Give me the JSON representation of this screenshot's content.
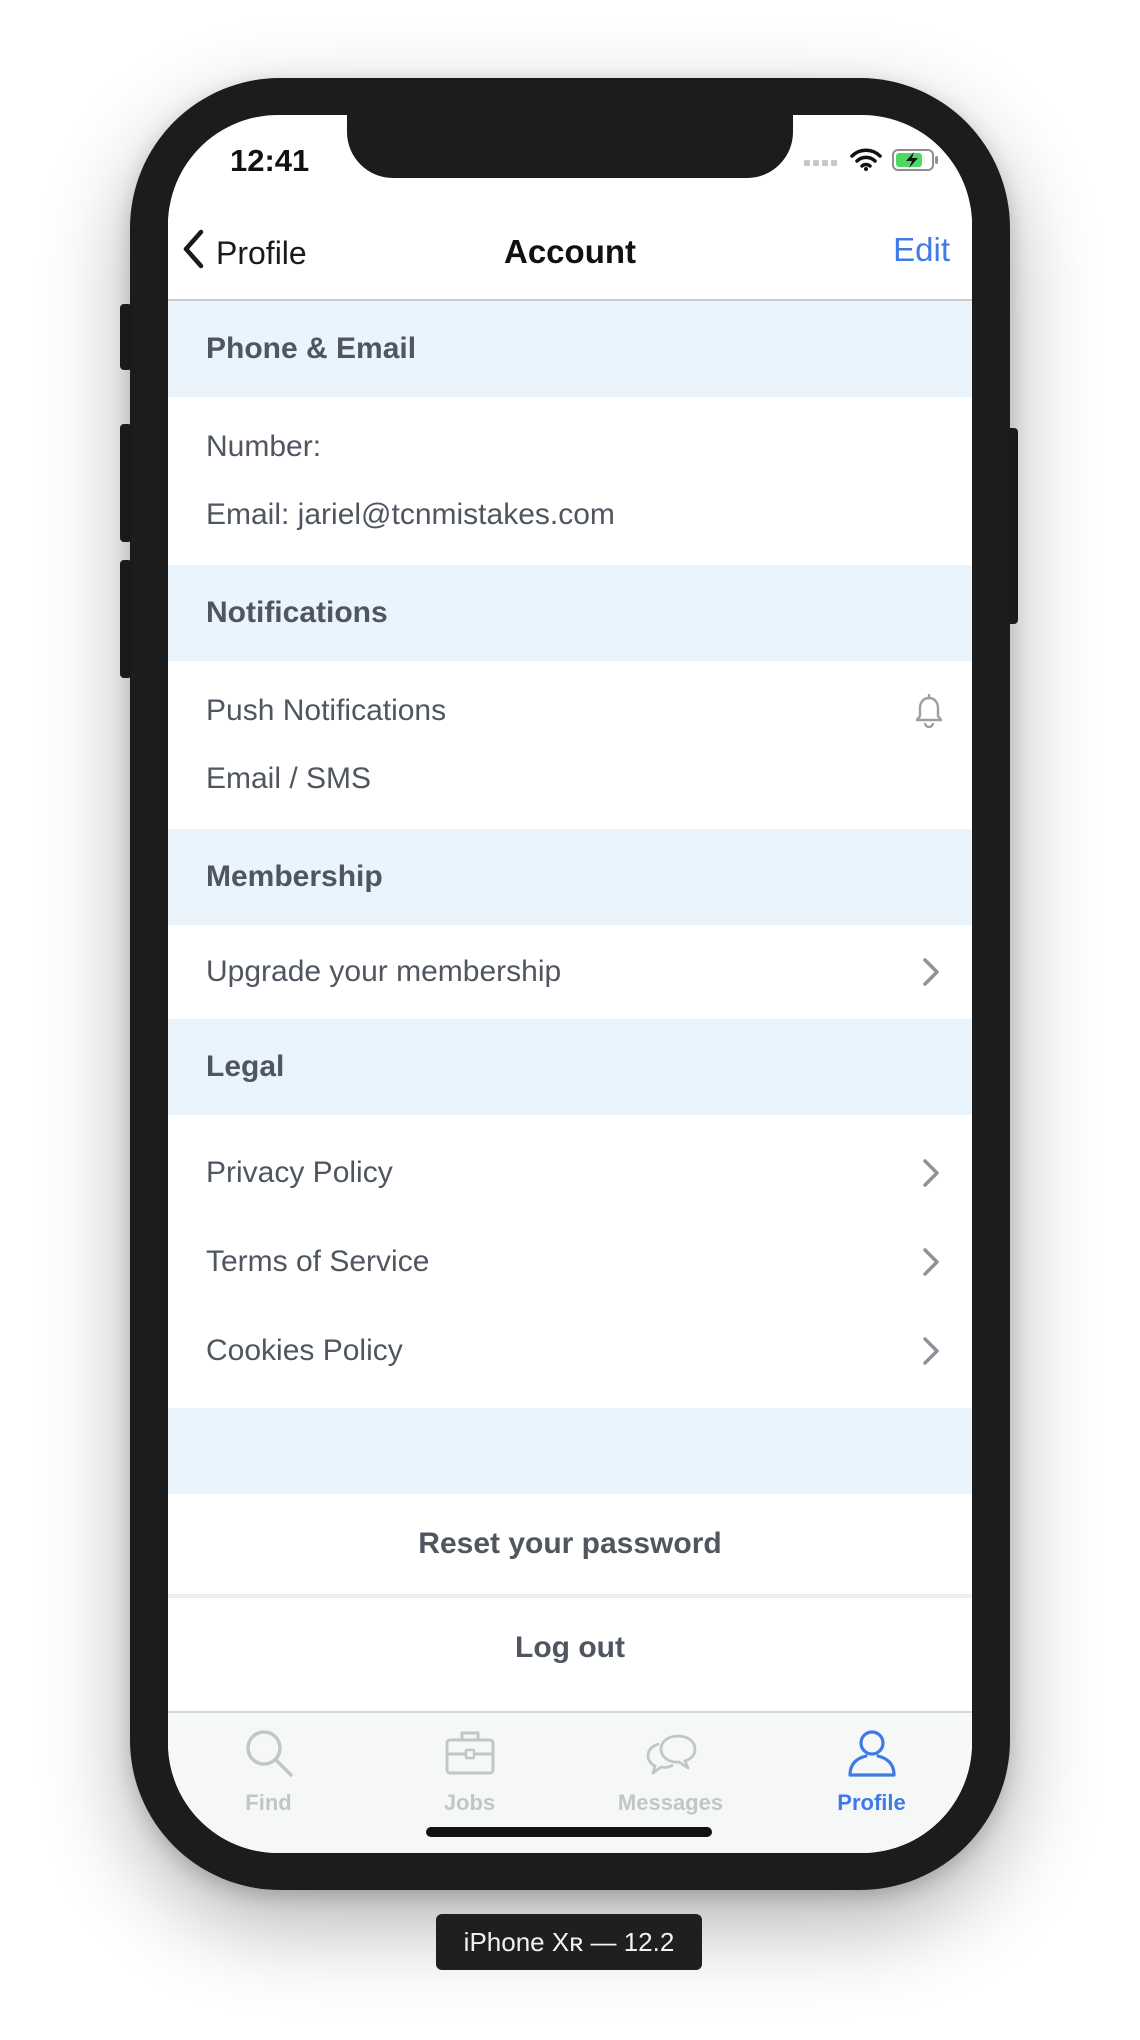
{
  "status_bar": {
    "time": "12:41"
  },
  "navbar": {
    "back_label": "Profile",
    "title": "Account",
    "edit_label": "Edit"
  },
  "sections": {
    "phone_email": {
      "header": "Phone & Email",
      "number_label": "Number:",
      "email_label": "Email: jariel@tcnmistakes.com"
    },
    "notifications": {
      "header": "Notifications",
      "push_label": "Push Notifications",
      "email_sms_label": "Email / SMS"
    },
    "membership": {
      "header": "Membership",
      "upgrade_label": "Upgrade your membership"
    },
    "legal": {
      "header": "Legal",
      "privacy_label": "Privacy Policy",
      "terms_label": "Terms of Service",
      "cookies_label": "Cookies Policy"
    }
  },
  "actions": {
    "reset_password": "Reset your password",
    "log_out": "Log out"
  },
  "tabbar": {
    "find": "Find",
    "jobs": "Jobs",
    "messages": "Messages",
    "profile": "Profile",
    "active": "profile"
  },
  "icons": {
    "back": "chevron-left-icon",
    "bell": "bell-icon",
    "chevron": "chevron-right-icon",
    "find": "search-icon",
    "jobs": "briefcase-icon",
    "messages": "chat-bubbles-icon",
    "profile": "person-icon"
  },
  "colors": {
    "accent": "#3e7be6",
    "section_bg": "#e9f4fd",
    "text": "#4f5660",
    "tab_inactive": "#c3c6c9",
    "battery_green": "#4cd964"
  },
  "device_label": "iPhone Xʀ — 12.2"
}
